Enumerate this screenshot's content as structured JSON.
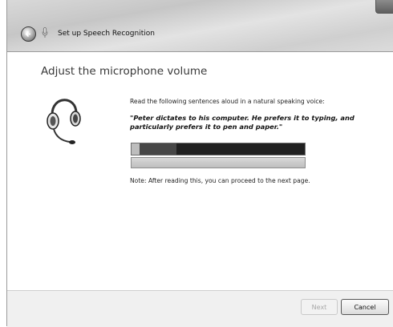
{
  "window": {
    "title": "Set up Speech Recognition"
  },
  "page": {
    "heading": "Adjust the microphone volume",
    "instruction": "Read the following sentences aloud in a natural speaking voice:",
    "quote": "\"Peter dictates to his computer. He prefers it to typing, and particularly prefers it to pen and paper.\"",
    "volume_level": 0.37,
    "note": "Note: After reading this, you can proceed to the next page."
  },
  "footer": {
    "next_label": "Next",
    "cancel_label": "Cancel"
  },
  "icons": {
    "back": "back-arrow-icon",
    "mic": "microphone-icon",
    "headset": "headset-icon",
    "close": "close-icon"
  }
}
